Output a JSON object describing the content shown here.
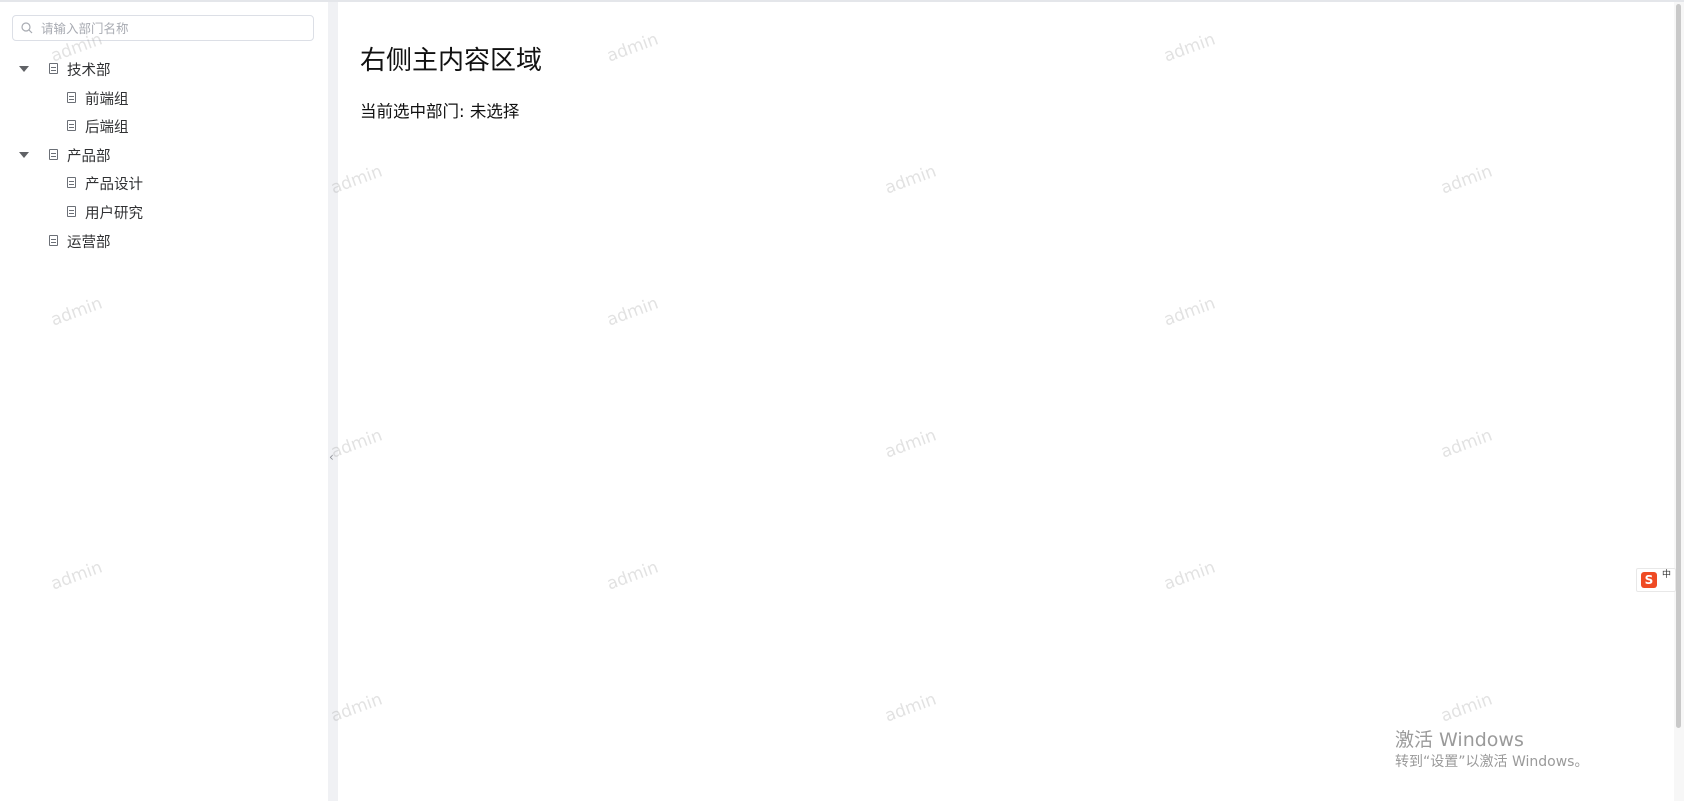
{
  "sidebar": {
    "search": {
      "placeholder": "请输入部门名称",
      "value": ""
    },
    "tree": [
      {
        "label": "技术部",
        "expanded": true,
        "children": [
          {
            "label": "前端组"
          },
          {
            "label": "后端组"
          }
        ]
      },
      {
        "label": "产品部",
        "expanded": true,
        "children": [
          {
            "label": "产品设计"
          },
          {
            "label": "用户研究"
          }
        ]
      },
      {
        "label": "运营部"
      }
    ]
  },
  "main": {
    "title": "右侧主内容区域",
    "selection_label": "当前选中部门:",
    "selection_value": "未选择"
  },
  "ime": {
    "logo": "S",
    "mode": "中"
  },
  "watermark_text": "admin",
  "activation": {
    "title": "激活 Windows",
    "subtitle": "转到“设置”以激活 Windows。"
  },
  "colors": {
    "ime_brand": "#ef4b24",
    "splitter": "#f0f1f4",
    "border": "#dcdfe6"
  }
}
